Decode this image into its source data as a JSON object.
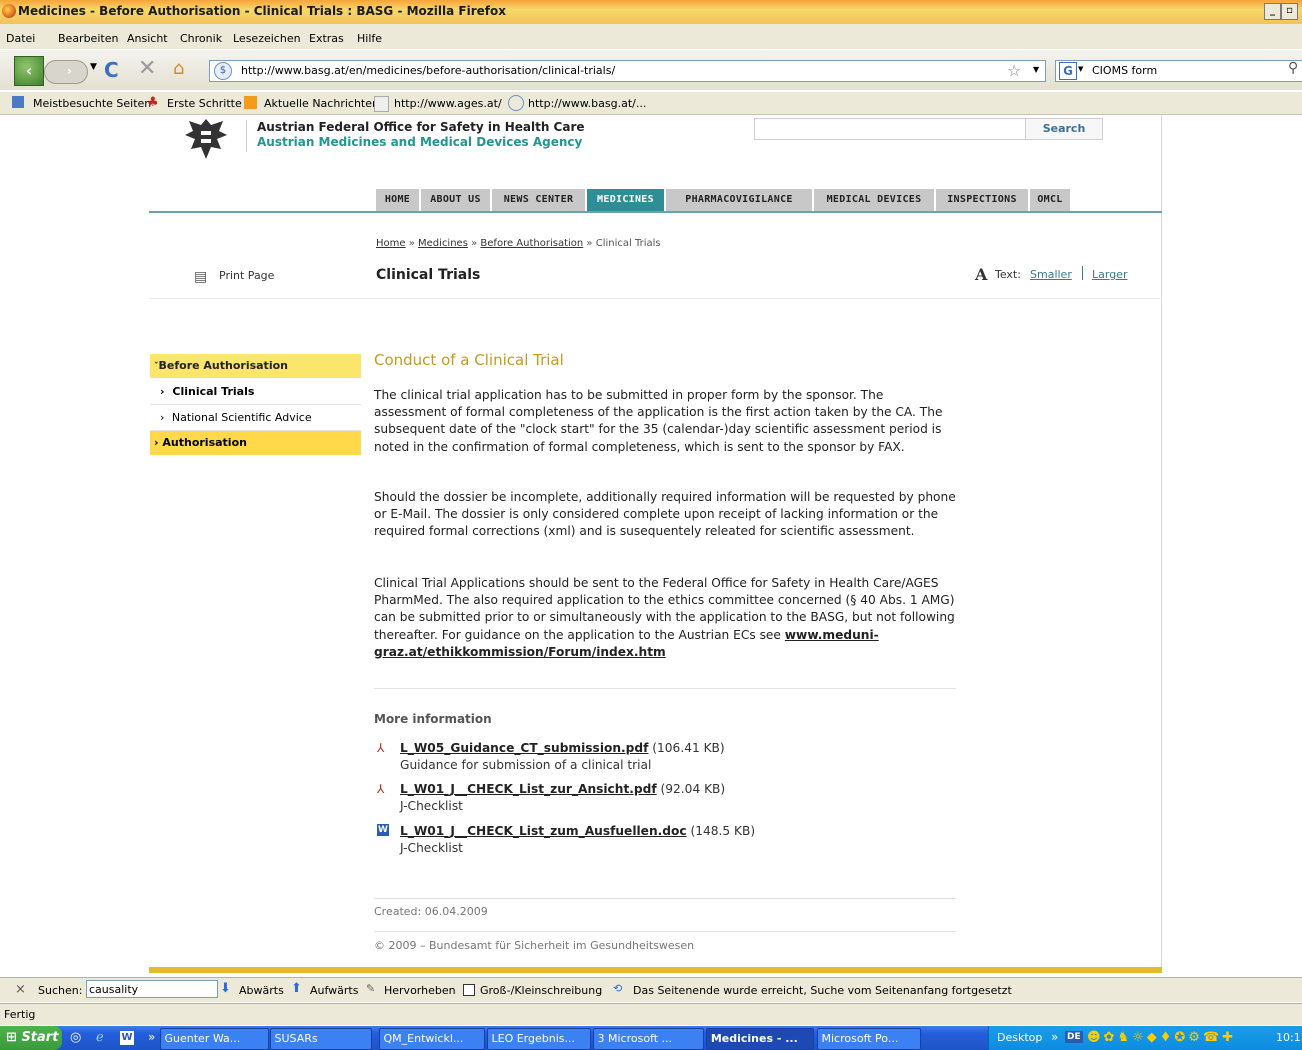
{
  "window": {
    "title": "Medicines - Before Authorisation - Clinical Trials : BASG - Mozilla Firefox"
  },
  "menu": [
    "Datei",
    "Bearbeiten",
    "Ansicht",
    "Chronik",
    "Lesezeichen",
    "Extras",
    "Hilfe"
  ],
  "nav": {
    "url": "http://www.basg.at/en/medicines/before-authorisation/clinical-trials/",
    "search_engine_text": "CIOMS form"
  },
  "bookmarks": [
    "Meistbesuchte Seiten",
    "Erste Schritte",
    "Aktuelle Nachrichten",
    "http://www.ages.at/",
    "http://www.basg.at/..."
  ],
  "site": {
    "org_name": "Austrian Federal Office for Safety in Health Care",
    "org_subtitle": "Austrian Medicines and Medical Devices Agency",
    "search_button": "Search",
    "topnav": [
      "HOME",
      "ABOUT US",
      "NEWS CENTER",
      "MEDICINES",
      "PHARMACOVIGILANCE",
      "MEDICAL DEVICES",
      "INSPECTIONS",
      "OMCL"
    ]
  },
  "breadcrumb": {
    "items": [
      "Home",
      "Medicines",
      "Before Authorisation"
    ],
    "current": "Clinical Trials",
    "sep": "»"
  },
  "page": {
    "print_label": "Print Page",
    "title": "Clinical Trials",
    "text_label": "Text:",
    "smaller": "Smaller",
    "larger": "Larger",
    "text_glyph": "A"
  },
  "sidenav": {
    "section": "Before Authorisation",
    "item1": "Clinical Trials",
    "item2": "National Scientific Advice",
    "item3": "Authorisation"
  },
  "article": {
    "heading": "Conduct of a Clinical Trial",
    "p1": "The clinical trial application has to be submitted in proper form by the sponsor. The assessment of formal completeness of the application is the first action taken by the CA. The subsequent date of the \"clock start\" for the 35 (calendar-)day scientific assessment period is noted in the confirmation of formal completeness, which is sent to the sponsor by FAX.",
    "p2": "Should the dossier be incomplete, additionally required information will be requested by phone or E-Mail. The dossier is only considered complete upon receipt of lacking information or the required formal corrections (xml) and is susequentely releated for scientific assessment.",
    "p3": "Clinical Trial Applications should be sent to the Federal Office for Safety in Health Care/AGES PharmMed. The also required application to the ethics committee concerned (§ 40 Abs. 1 AMG) can be submitted prior to or simultaneously with the application to the BASG, but not following thereafter. For guidance on the application to the Austrian ECs see",
    "p3_link": "www.meduni-graz.at/ethikkommission/Forum/index.htm",
    "more_info": "More information",
    "files": [
      {
        "name": "L_W05_Guidance_CT_submission.pdf",
        "size": "(106.41 KB)",
        "desc": "Guidance for submission of a clinical trial",
        "type": "pdf-icon"
      },
      {
        "name": "L_W01_J__CHECK_List_zur_Ansicht.pdf",
        "size": "(92.04 KB)",
        "desc": "J-Checklist",
        "type": "pdf-icon"
      },
      {
        "name": "L_W01_J__CHECK_List_zum_Ausfuellen.doc",
        "size": "(148.5 KB)",
        "desc": "J-Checklist",
        "type": "word-icon"
      }
    ],
    "created": "Created: 06.04.2009",
    "copyright": "© 2009 – Bundesamt für Sicherheit im Gesundheitswesen"
  },
  "findbar": {
    "label": "Suchen:",
    "value": "causality",
    "down": "Abwärts",
    "up": "Aufwärts",
    "highlight": "Hervorheben",
    "matchcase": "Groß-/Kleinschreibung",
    "status": "Das Seitenende wurde erreicht, Suche vom Seitenanfang fortgesetzt"
  },
  "statusbar": {
    "text": "Fertig"
  },
  "taskbar": {
    "start": "Start",
    "items": [
      "Guenter Wa...",
      "SUSARs",
      "QM_Entwickl...",
      "LEO Ergebnis...",
      "3 Microsoft ...",
      "Medicines - ...",
      "Microsoft Po..."
    ],
    "desktop": "Desktop",
    "lang": "DE",
    "clock": "10:1",
    "chevron": "»"
  },
  "colors": {
    "accent_teal": "#2e8d95",
    "heading_gold": "#c69a1e",
    "sidebar_yellow": "#fbe56a",
    "sidebar_active": "#ffd94a"
  }
}
